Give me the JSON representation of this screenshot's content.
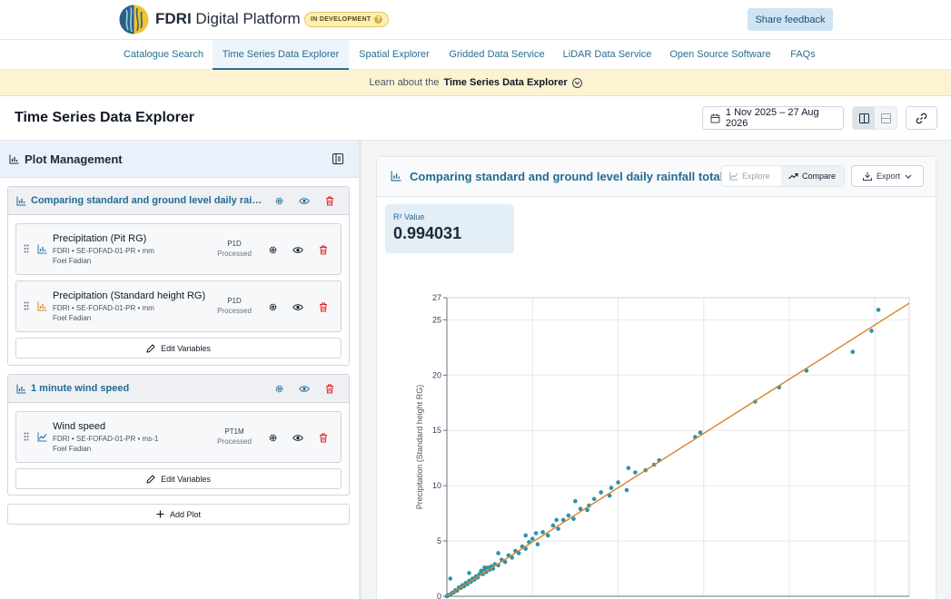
{
  "header": {
    "brand_bold": "FDRI",
    "brand_rest": "Digital Platform",
    "badge": "IN DEVELOPMENT",
    "badge_help": "?",
    "feedback": "Share feedback"
  },
  "nav": {
    "tabs": [
      {
        "label": "Catalogue Search",
        "active": false
      },
      {
        "label": "Time Series Data Explorer",
        "active": true
      },
      {
        "label": "Spatial Explorer",
        "active": false
      },
      {
        "label": "Gridded Data Service",
        "active": false
      },
      {
        "label": "LiDAR Data Service",
        "active": false
      },
      {
        "label": "Open Source Software",
        "active": false
      },
      {
        "label": "FAQs",
        "active": false
      }
    ]
  },
  "learn": {
    "prefix": "Learn about the",
    "bold": "Time Series Data Explorer"
  },
  "page": {
    "title": "Time Series Data Explorer",
    "date_range": "1 Nov 2025 – 27 Aug 2026"
  },
  "plot_management": {
    "title": "Plot Management",
    "groups": [
      {
        "title": "Comparing standard and ground level daily rainfall totals",
        "variables": [
          {
            "name": "Precipitation (Pit RG)",
            "meta": "FDRI • SE-FOFAD-01-PR • mm",
            "site": "Foel Fadian",
            "code": "P1D",
            "status": "Processed",
            "icon_color": "#2a7bb5"
          },
          {
            "name": "Precipitation (Standard height RG)",
            "meta": "FDRI • SE-FOFAD-01-PR • mm",
            "site": "Foel Fadian",
            "code": "P1D",
            "status": "Processed",
            "icon_color": "#d9822b"
          }
        ],
        "edit_label": "Edit Variables"
      },
      {
        "title": "1 minute wind speed",
        "variables": [
          {
            "name": "Wind speed",
            "meta": "FDRI • SE-FOFAD-01-PR • ms-1",
            "site": "Foel Fadian",
            "code": "PT1M",
            "status": "Processed",
            "icon_color": "#2a7bb5"
          }
        ],
        "edit_label": "Edit Variables"
      }
    ],
    "add_plot": "Add Plot"
  },
  "plot_card": {
    "title": "Comparing standard and ground level daily rainfall totals",
    "mode_explore": "Explore",
    "mode_compare": "Compare",
    "active_mode": "Compare",
    "export": "Export",
    "r2_label": "R² Value",
    "r2_value": "0.994031"
  },
  "chart_data": {
    "type": "scatter",
    "ylabel": "Precipitation (Standard height RG)",
    "xlabel": "",
    "ylim": [
      0,
      27
    ],
    "xlim": [
      0,
      27
    ],
    "yticks": [
      0,
      5,
      10,
      15,
      20,
      25,
      27
    ],
    "grid": true,
    "point_color": "#2b93a8",
    "line_color": "#d9822b",
    "trend_line": {
      "x": [
        0,
        27
      ],
      "y": [
        0,
        26.5
      ]
    },
    "points": [
      [
        0,
        0
      ],
      [
        0.1,
        0.1
      ],
      [
        0.2,
        0.15
      ],
      [
        0.3,
        0.3
      ],
      [
        0.4,
        0.35
      ],
      [
        0.5,
        0.55
      ],
      [
        0.6,
        0.5
      ],
      [
        0.7,
        0.8
      ],
      [
        0.8,
        0.75
      ],
      [
        0.9,
        1.0
      ],
      [
        1.0,
        0.9
      ],
      [
        1.1,
        1.2
      ],
      [
        1.2,
        1.1
      ],
      [
        1.3,
        1.4
      ],
      [
        1.4,
        1.3
      ],
      [
        1.5,
        1.6
      ],
      [
        1.6,
        1.5
      ],
      [
        1.7,
        1.8
      ],
      [
        1.8,
        1.7
      ],
      [
        1.9,
        2.0
      ],
      [
        2.0,
        2.3
      ],
      [
        2.1,
        2.0
      ],
      [
        2.2,
        2.4
      ],
      [
        2.3,
        2.2
      ],
      [
        2.4,
        2.6
      ],
      [
        2.5,
        2.4
      ],
      [
        2.6,
        2.7
      ],
      [
        2.7,
        2.5
      ],
      [
        2.8,
        2.9
      ],
      [
        3.0,
        2.8
      ],
      [
        3.2,
        3.3
      ],
      [
        3.4,
        3.1
      ],
      [
        3.6,
        3.7
      ],
      [
        3.8,
        3.5
      ],
      [
        4.0,
        4.1
      ],
      [
        4.2,
        3.9
      ],
      [
        4.4,
        4.5
      ],
      [
        4.6,
        4.3
      ],
      [
        4.8,
        4.9
      ],
      [
        5.0,
        5.2
      ],
      [
        5.3,
        4.7
      ],
      [
        5.6,
        5.8
      ],
      [
        5.9,
        5.5
      ],
      [
        6.2,
        6.4
      ],
      [
        6.5,
        6.1
      ],
      [
        6.8,
        6.9
      ],
      [
        7.1,
        7.3
      ],
      [
        7.4,
        7.0
      ],
      [
        7.8,
        7.9
      ],
      [
        8.2,
        7.8
      ],
      [
        8.6,
        8.8
      ],
      [
        9.0,
        9.4
      ],
      [
        9.5,
        9.1
      ],
      [
        10.0,
        10.3
      ],
      [
        10.5,
        9.6
      ],
      [
        11.0,
        11.2
      ],
      [
        11.6,
        11.4
      ],
      [
        12.1,
        11.9
      ],
      [
        12.4,
        12.3
      ],
      [
        14.5,
        14.4
      ],
      [
        14.8,
        14.8
      ],
      [
        18.0,
        17.6
      ],
      [
        19.4,
        18.9
      ],
      [
        21.0,
        20.4
      ],
      [
        23.7,
        22.1
      ],
      [
        24.8,
        24.0
      ],
      [
        25.2,
        25.9
      ],
      [
        0.2,
        1.6
      ],
      [
        1.3,
        2.1
      ],
      [
        2.2,
        2.6
      ],
      [
        3.0,
        3.9
      ],
      [
        4.6,
        5.5
      ],
      [
        5.2,
        5.7
      ],
      [
        6.4,
        6.9
      ],
      [
        7.5,
        8.6
      ],
      [
        8.3,
        8.2
      ],
      [
        9.6,
        9.8
      ],
      [
        10.6,
        11.6
      ]
    ]
  }
}
